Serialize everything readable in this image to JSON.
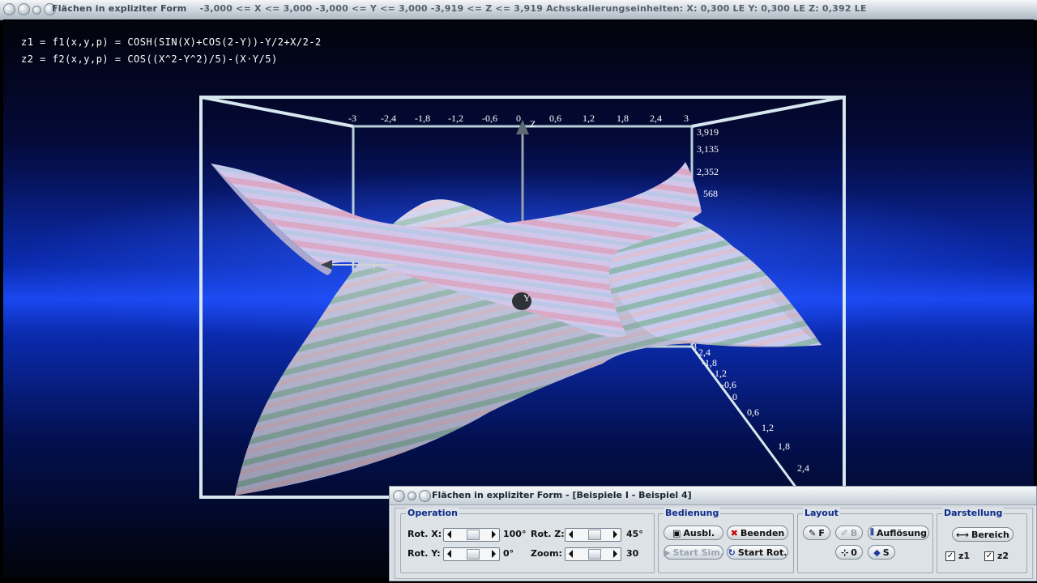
{
  "window": {
    "title": "Flächen in expliziter Form",
    "range_info": "-3,000 <= X <= 3,000  -3,000 <= Y <= 3,000  -3,919 <= Z <= 3,919  Achsskalierungseinheiten:  X: 0,300 LE    Y: 0,300 LE    Z: 0,392 LE"
  },
  "formulas": {
    "z1": "z1 = f1(x,y,p) = COSH(SIN(X)+COS(2-Y))-Y/2+X/2-2",
    "z2": "z2 = f2(x,y,p) = COS((X^2-Y^2)/5)-(X·Y/5)"
  },
  "axes": {
    "x_ticks": [
      "-3",
      "-2,4",
      "-1,8",
      "-1,2",
      "-0,6",
      "0",
      "0,6",
      "1,2",
      "1,8",
      "2,4",
      "3"
    ],
    "z_ticks": [
      "3,919",
      "3,135",
      "2,352",
      "568"
    ],
    "y_ticks": [
      "-3",
      "-2,4",
      "-1,8",
      "-1,2",
      "-0,6",
      "0",
      "0,6",
      "1,2",
      "1,8",
      "2,4"
    ],
    "z_label": "Z",
    "y_label": "Y"
  },
  "colors": {
    "surface_stripe_a": "#c7c8ec",
    "surface_stripe_b": "#8fb7b0",
    "surface_stripe_c": "#d9b3c9",
    "frame": "#cfe3ea"
  },
  "panel": {
    "title": "Flächen in expliziter Form - [Beispiele I - Beispiel 4]",
    "operation": {
      "heading": "Operation",
      "rot_x_label": "Rot. X:",
      "rot_x_value": "100°",
      "rot_y_label": "Rot. Y:",
      "rot_y_value": "0°",
      "rot_z_label": "Rot. Z:",
      "rot_z_value": "45°",
      "zoom_label": "Zoom:",
      "zoom_value": "30"
    },
    "bedienung": {
      "heading": "Bedienung",
      "ausbl": "Ausbl.",
      "beenden": "Beenden",
      "start_sim": "Start Sim.",
      "start_rot": "Start Rot."
    },
    "layout": {
      "heading": "Layout",
      "f": "F",
      "b": "B",
      "aufloesung": "Auflösung",
      "zero": "0",
      "s": "S"
    },
    "darstellung": {
      "heading": "Darstellung",
      "bereich": "Bereich",
      "z1": "z1",
      "z2": "z2",
      "z1_checked": true,
      "z2_checked": true
    }
  }
}
